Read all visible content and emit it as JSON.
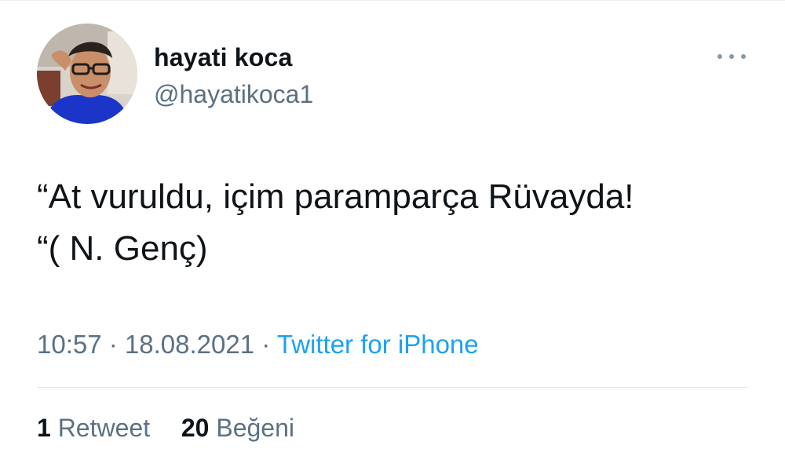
{
  "author": {
    "name": "hayati koca",
    "handle": "@hayatikoca1",
    "avatar_icon": "profile-photo"
  },
  "more_icon": "ellipsis-icon",
  "tweet": {
    "lines": [
      "“At vuruldu, içim paramparça Rüvayda!",
      "“( N. Genç)"
    ]
  },
  "meta": {
    "time": "10:57",
    "separator": "·",
    "date": "18.08.2021",
    "source": "Twitter for iPhone"
  },
  "stats": {
    "retweets_count": "1",
    "retweets_label": "Retweet",
    "likes_count": "20",
    "likes_label": "Beğeni"
  },
  "colors": {
    "text": "#0f1419",
    "secondary": "#5b7083",
    "link": "#1da1f2",
    "divider": "#e1e8ed"
  }
}
